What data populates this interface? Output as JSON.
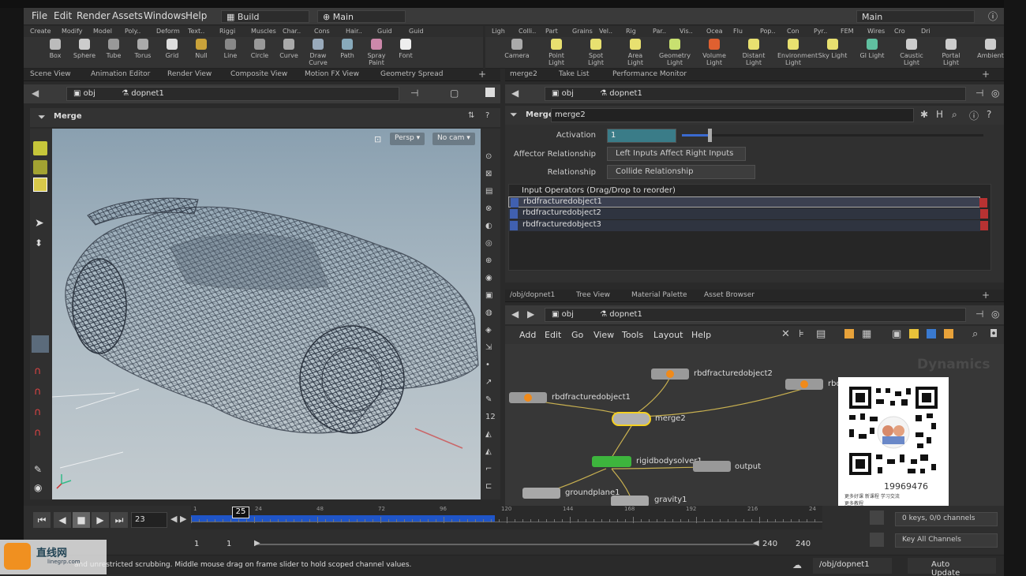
{
  "menu": {
    "items": [
      "File",
      "Edit",
      "Render",
      "Assets",
      "Windows",
      "Help"
    ],
    "desktop": "Build",
    "network": "Main",
    "right_label": "Main"
  },
  "shelf_left": {
    "tabs": [
      "Create",
      "Modify",
      "Model",
      "Poly..",
      "Deform",
      "Text..",
      "Riggi",
      "Muscles",
      "Char..",
      "Cons",
      "Hair..",
      "Guid",
      "Guid"
    ],
    "tools": [
      "Box",
      "Sphere",
      "Tube",
      "Torus",
      "Grid",
      "Null",
      "Line",
      "Circle",
      "Curve",
      "Draw Curve",
      "Path",
      "Spray Paint",
      "Font"
    ]
  },
  "shelf_right": {
    "tabs": [
      "Ligh",
      "Colli..",
      "Part",
      "Grains",
      "Vel..",
      "Rig",
      "Par..",
      "Vis..",
      "Ocea",
      "Flu",
      "Pop..",
      "Con",
      "Pyr..",
      "FEM",
      "Wires",
      "Cro",
      "Dri"
    ],
    "tools": [
      "Camera",
      "Point Light",
      "Spot Light",
      "Area Light",
      "Geometry Light",
      "Volume Light",
      "Distant Light",
      "Environment Light",
      "Sky Light",
      "GI Light",
      "Caustic Light",
      "Portal Light",
      "Ambient"
    ]
  },
  "left_pane": {
    "tabs": [
      "Scene View",
      "Animation Editor",
      "Render View",
      "Composite View",
      "Motion FX View",
      "Geometry Spread"
    ],
    "path_obj": "obj",
    "path_node": "dopnet1",
    "title": "Merge",
    "persp": "Persp",
    "cam": "No cam"
  },
  "params_pane": {
    "tabs": [
      "merge2",
      "Take List",
      "Performance Monitor"
    ],
    "path_obj": "obj",
    "path_node": "dopnet1",
    "node_type": "Merge",
    "node_name": "merge2",
    "activation_label": "Activation",
    "activation_value": "1",
    "affector_label": "Affector Relationship",
    "affector_value": "Left Inputs Affect Right Inputs",
    "relationship_label": "Relationship",
    "relationship_value": "Collide Relationship",
    "list_header": "Input Operators (Drag/Drop to reorder)",
    "inputs": [
      "rbdfracturedobject1",
      "rbdfracturedobject2",
      "rbdfracturedobject3"
    ]
  },
  "network_pane": {
    "tabs": [
      "/obj/dopnet1",
      "Tree View",
      "Material Palette",
      "Asset Browser"
    ],
    "path_obj": "obj",
    "path_node": "dopnet1",
    "menus": [
      "Add",
      "Edit",
      "Go",
      "View",
      "Tools",
      "Layout",
      "Help"
    ],
    "watermark": "Dynamics",
    "nodes": [
      "rbdfracturedobject2",
      "rbdfracturedobject1",
      "merge2",
      "rigidbodysolver1",
      "output",
      "groundplane1",
      "gravity1",
      "rbd"
    ]
  },
  "timeline": {
    "frame": "23",
    "marker": "25",
    "ticks": [
      "1",
      "24",
      "48",
      "72",
      "96",
      "120",
      "144",
      "168",
      "192",
      "216",
      "24"
    ],
    "keys": "0 keys, 0/0 channels",
    "key_all": "Key All Channels",
    "start": "1",
    "start2": "1",
    "end": "240",
    "end2": "240"
  },
  "status": {
    "message": "and unrestricted scrubbing. Middle mouse drag on frame slider to hold scoped channel values.",
    "path": "/obj/dopnet1",
    "update": "Auto Update",
    "logo_text": "直线网",
    "logo_sub": "linegrp.com"
  },
  "qr": {
    "line1": "19969476",
    "line2": "更多好课 新课程 学习交流",
    "line3": "更多教程 "
  },
  "colors": {
    "accent_blue": "#1f55c8",
    "node_orange": "#f08a1a",
    "selected_yellow": "#f5d020",
    "solver_green": "#3db53d"
  }
}
